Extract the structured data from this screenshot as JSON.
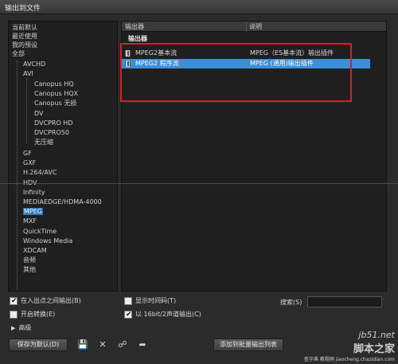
{
  "window": {
    "title": "输出到文件"
  },
  "tree": {
    "items": [
      "当前默认",
      "最近使用",
      "我的预设",
      "全部",
      "AVCHD",
      "AVI",
      "Canopus HQ",
      "Canopus HQX",
      "Canopus 无损",
      "DV",
      "DVCPRO HD",
      "DVCPRO50",
      "无压缩",
      "GF",
      "GXF",
      "H.264/AVC",
      "HDV",
      "Infinity",
      "MEDIAEDGE/HDMA-4000",
      "MPEG",
      "MXF",
      "QuickTime",
      "Windows Media",
      "XDCAM",
      "音频",
      "其他"
    ],
    "selected_index": 19
  },
  "list": {
    "header_exporter": "输出器",
    "header_description": "说明",
    "group_title": "输出器",
    "rows": [
      {
        "name": "MPEG2基本流",
        "description": "MPEG（ES基本流）输出插件"
      },
      {
        "name": "MPEG2 程序流",
        "description": "MPEG (通用)输出插件"
      }
    ],
    "selected_row": 1
  },
  "options": {
    "in_out_label": "在入出点之间输出(B)",
    "in_out_checked": true,
    "enable_convert_label": "开启转换(E)",
    "enable_convert_checked": false,
    "show_timecode_label": "显示时间码(T)",
    "show_timecode_checked": false,
    "audio_16bit_label": "以 16bit/2声道输出(C)",
    "audio_16bit_checked": true
  },
  "search": {
    "label": "搜索(S)",
    "value": ""
  },
  "advanced": {
    "label": "高级"
  },
  "buttons": {
    "save_default": "保存为默认(D)",
    "add_batch": "添加到批量输出列表"
  },
  "icons": [
    "save-icon",
    "delete-icon",
    "link-icon",
    "export-icon"
  ],
  "watermark": {
    "line1": "jb51.net",
    "line2": "脚本之家",
    "line3": "查字典 教程网 jiaocheng.chazidian.com"
  },
  "colors": {
    "selection": "#3a8fd9",
    "tree_selection": "#2f72b8",
    "annotation": "#d11f2a"
  }
}
